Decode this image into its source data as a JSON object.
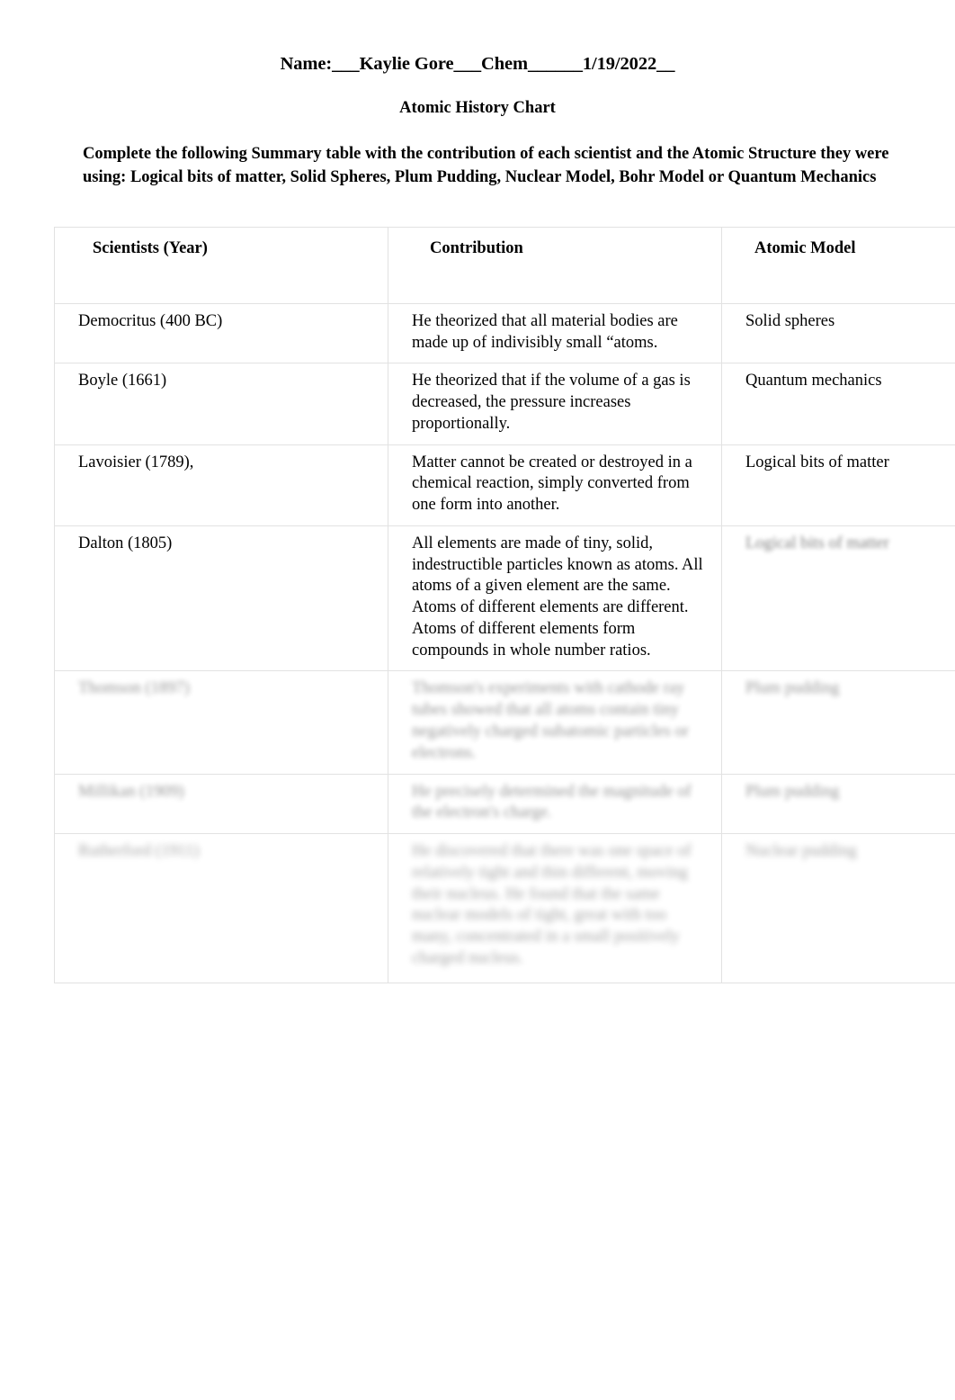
{
  "header": {
    "name_line": "Name:___Kaylie Gore___Chem______1/19/2022__",
    "student_name": "Kaylie Gore",
    "course": "Chem",
    "date": "1/19/2022",
    "title": "Atomic History Chart"
  },
  "instructions": {
    "text": "Complete the following Summary table with the contribution of each scientist and the Atomic Structure they were using: Logical bits of matter, Solid Spheres, Plum Pudding, Nuclear Model, Bohr Model or Quantum Mechanics"
  },
  "table": {
    "columns": [
      "Scientists (Year)",
      "Contribution",
      "Atomic Model"
    ],
    "rows": [
      {
        "scientist": "Democritus (400 BC)",
        "contribution": "He theorized that all material bodies are made up of indivisibly small “atoms.",
        "model": "Solid spheres",
        "blur": 0
      },
      {
        "scientist": "Boyle (1661)",
        "contribution": "He theorized that if the volume of a gas is decreased, the pressure increases proportionally.",
        "model": "Quantum mechanics",
        "blur": 0
      },
      {
        "scientist": "Lavoisier (1789),",
        "contribution": "Matter cannot be created or destroyed in a chemical reaction, simply converted from one form into another.",
        "model": "Logical bits of matter",
        "blur": 0
      },
      {
        "scientist": "Dalton (1805)",
        "contribution": "All elements are made of tiny, solid,  indestructible particles known as atoms. All atoms of a given element are the same. Atoms of different elements are different. Atoms of different elements form compounds in whole number ratios.",
        "model": "Logical bits of matter",
        "blur": 1
      },
      {
        "scientist": "Thomson (1897)",
        "contribution": "Thomson's experiments with cathode ray tubes showed that all atoms contain tiny negatively charged subatomic particles or electrons.",
        "model": "Plum pudding",
        "blur": 2
      },
      {
        "scientist": "Millikan (1909)",
        "contribution": "He precisely determined the magnitude of the electron's charge.",
        "model": "Plum pudding",
        "blur": 2
      },
      {
        "scientist": "Rutherford (1911)",
        "contribution": "He discovered that there was one space of relatively  tight and thin different, moving their nucleus. He found that the same nuclear models of tight, great with too many, concentrated in a small positively charged nucleus.",
        "model": "Nuclear pudding",
        "blur": 3
      }
    ]
  },
  "colors": {
    "page_background": "#ffffff",
    "text": "#000000",
    "table_border": "#e2e2e2"
  }
}
